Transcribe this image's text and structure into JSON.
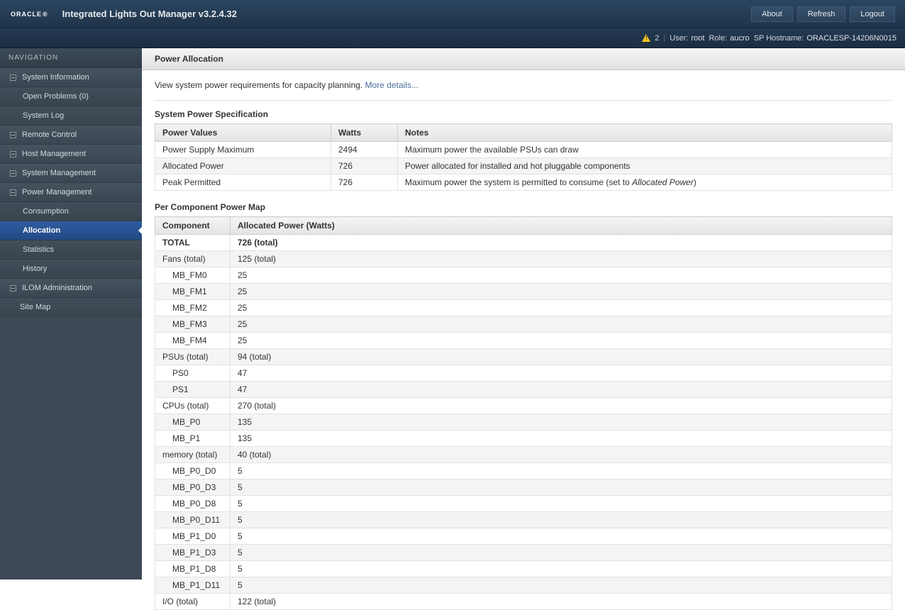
{
  "header": {
    "logo": "ORACLE",
    "logo_reg": "®",
    "title": "Integrated Lights Out Manager v3.2.4.32",
    "buttons": {
      "about": "About",
      "refresh": "Refresh",
      "logout": "Logout"
    }
  },
  "subheader": {
    "warn_count": "2",
    "user_label": "User:",
    "user_value": "root",
    "role_label": "Role:",
    "role_value": "aucro",
    "host_label": "SP Hostname:",
    "host_value": "ORACLESP-14206N0015"
  },
  "nav": {
    "title": "NAVIGATION",
    "items": {
      "system_information": "System Information",
      "open_problems": "Open Problems (0)",
      "system_log": "System Log",
      "remote_control": "Remote Control",
      "host_management": "Host Management",
      "system_management": "System Management",
      "power_management": "Power Management",
      "consumption": "Consumption",
      "allocation": "Allocation",
      "statistics": "Statistics",
      "history": "History",
      "ilom_admin": "ILOM Administration",
      "site_map": "Site Map"
    }
  },
  "page": {
    "title": "Power Allocation",
    "intro_text": "View system power requirements for capacity planning. ",
    "more_details": "More details...",
    "section_spec": "System Power Specification",
    "section_map": "Per Component Power Map",
    "spec_headers": {
      "pv": "Power Values",
      "w": "Watts",
      "n": "Notes"
    },
    "spec_rows": [
      {
        "pv": "Power Supply Maximum",
        "w": "2494",
        "n": "Maximum power the available PSUs can draw"
      },
      {
        "pv": "Allocated Power",
        "w": "726",
        "n": "Power allocated for installed and hot pluggable components"
      },
      {
        "pv": "Peak Permitted",
        "w": "726",
        "n_pre": "Maximum power the system is permitted to consume (set to ",
        "n_italic": "Allocated Power",
        "n_post": ")"
      }
    ],
    "comp_headers": {
      "c": "Component",
      "a": "Allocated Power (Watts)"
    },
    "comp_rows": [
      {
        "c": "TOTAL",
        "a": "726 (total)",
        "bold": true
      },
      {
        "c": "Fans (total)",
        "a": "125 (total)"
      },
      {
        "c": "MB_FM0",
        "a": "25",
        "indent": true
      },
      {
        "c": "MB_FM1",
        "a": "25",
        "indent": true
      },
      {
        "c": "MB_FM2",
        "a": "25",
        "indent": true
      },
      {
        "c": "MB_FM3",
        "a": "25",
        "indent": true
      },
      {
        "c": "MB_FM4",
        "a": "25",
        "indent": true
      },
      {
        "c": "PSUs (total)",
        "a": "94 (total)"
      },
      {
        "c": "PS0",
        "a": "47",
        "indent": true
      },
      {
        "c": "PS1",
        "a": "47",
        "indent": true
      },
      {
        "c": "CPUs (total)",
        "a": "270 (total)"
      },
      {
        "c": "MB_P0",
        "a": "135",
        "indent": true
      },
      {
        "c": "MB_P1",
        "a": "135",
        "indent": true
      },
      {
        "c": "memory (total)",
        "a": "40 (total)"
      },
      {
        "c": "MB_P0_D0",
        "a": "5",
        "indent": true
      },
      {
        "c": "MB_P0_D3",
        "a": "5",
        "indent": true
      },
      {
        "c": "MB_P0_D8",
        "a": "5",
        "indent": true
      },
      {
        "c": "MB_P0_D11",
        "a": "5",
        "indent": true
      },
      {
        "c": "MB_P1_D0",
        "a": "5",
        "indent": true
      },
      {
        "c": "MB_P1_D3",
        "a": "5",
        "indent": true
      },
      {
        "c": "MB_P1_D8",
        "a": "5",
        "indent": true
      },
      {
        "c": "MB_P1_D11",
        "a": "5",
        "indent": true
      },
      {
        "c": "I/O (total)",
        "a": "122 (total)"
      }
    ]
  }
}
